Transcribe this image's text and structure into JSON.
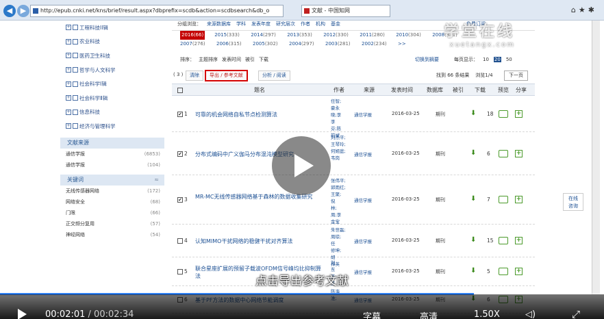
{
  "browser": {
    "url": "http://epub.cnki.net/kns/brief/result.aspx?dbprefix=scdb&action=scdbsearch&db_o",
    "tab_title": "文献 - 中国知网",
    "icons": [
      "home-icon",
      "star-icon",
      "gear-icon"
    ]
  },
  "sidebar": {
    "categories": [
      {
        "label": "工程科技II辑"
      },
      {
        "label": "农业科技"
      },
      {
        "label": "医药卫生科技"
      },
      {
        "label": "哲学与人文科学"
      },
      {
        "label": "社会科学Ⅰ辑"
      },
      {
        "label": "社会科学Ⅱ辑"
      },
      {
        "label": "信息科技"
      },
      {
        "label": "经济与管理科学"
      }
    ],
    "sources_title": "文献来源",
    "sources": [
      {
        "label": "通信学报",
        "count": "(6853)"
      },
      {
        "label": "通信学报",
        "count": "(104)"
      }
    ],
    "keywords_title": "关键词",
    "keywords_toggle": "≈",
    "keywords": [
      {
        "label": "无线传感器网络",
        "count": "(172)"
      },
      {
        "label": "网络安全",
        "count": "(68)"
      },
      {
        "label": "门限",
        "count": "(66)"
      },
      {
        "label": "正交频分复用",
        "count": "(57)"
      },
      {
        "label": "神经网络",
        "count": "(54)"
      }
    ]
  },
  "filters": {
    "items": [
      "分组浏览：",
      "来源数据库",
      "学科",
      "发表年度",
      "研究层次",
      "作者",
      "机构",
      "基金"
    ],
    "right_text": "免费订阅"
  },
  "years": {
    "row1": [
      {
        "y": "2016",
        "n": "(66)",
        "selected": true
      },
      {
        "y": "2015",
        "n": "(333)"
      },
      {
        "y": "2014",
        "n": "(297)"
      },
      {
        "y": "2013",
        "n": "(353)"
      },
      {
        "y": "2012",
        "n": "(330)"
      },
      {
        "y": "2011",
        "n": "(280)"
      },
      {
        "y": "2010",
        "n": "(304)"
      },
      {
        "y": "2008",
        "n": "(371)"
      }
    ],
    "row2": [
      {
        "y": "2007",
        "n": "(276)"
      },
      {
        "y": "2006",
        "n": "(315)"
      },
      {
        "y": "2005",
        "n": "(302)"
      },
      {
        "y": "2004",
        "n": "(297)"
      },
      {
        "y": "2003",
        "n": "(281)"
      },
      {
        "y": "2002",
        "n": "(234)"
      },
      {
        "y": ">>",
        "n": ""
      }
    ]
  },
  "sortbar": {
    "items": [
      "排序：",
      "主题排序",
      "发表时间",
      "被引",
      "下载"
    ],
    "switch_label": "切换到摘要",
    "per_page_label": "每页显示：",
    "page_sizes": [
      "10",
      "20",
      "50"
    ],
    "selected_size": "20"
  },
  "toolbar": {
    "selected_count": "( 3 )",
    "clear": "清除",
    "export": "导出 / 参考文献",
    "analyze": "分析 / 阅读",
    "result_info": "找到 66 条结果",
    "page_info": "浏览1/4",
    "next": "下一页"
  },
  "table": {
    "headers": {
      "select": "",
      "title": "题名",
      "author": "作者",
      "source": "来源",
      "date": "发表时间",
      "db": "数据库",
      "cited": "被引",
      "download": "下载",
      "preview": "预览",
      "share": "分享"
    },
    "rows": [
      {
        "checked": true,
        "num": "1",
        "title": "可靠的机会网络自私节点检测算法",
        "authors": [
          "任智;",
          "豪永",
          "晓;李",
          "李",
          "芬;陈",
          "前斌"
        ],
        "source": "通信学报",
        "date": "2016-03-25",
        "db": "期刊",
        "downloads": "18"
      },
      {
        "checked": true,
        "num": "2",
        "title": "分布式编码中广义伽马分布混沌模型研究",
        "authors": [
          "刘杰平;",
          "王琴玲;",
          "何姬庭;",
          "韦岗"
        ],
        "source": "通信学报",
        "date": "2016-03-25",
        "db": "期刊",
        "downloads": "6"
      },
      {
        "checked": true,
        "num": "3",
        "title": "MR-MC无线传感器网络基于森林的数据收集研究",
        "authors": [
          "张伟平;",
          "郭雨红;",
          "王聚;",
          "倪",
          "林;",
          "周;李",
          "金宝"
        ],
        "source": "通信学报",
        "date": "2016-03-25",
        "db": "期刊",
        "downloads": "7"
      },
      {
        "checked": false,
        "num": "4",
        "title": "认知MIMO干扰网络的稳健干扰对齐算法",
        "authors": [
          "朱世磊;",
          "周琼;",
          "任",
          "修坤;",
          "胡",
          "捍英"
        ],
        "source": "通信学报",
        "date": "2016-03-25",
        "db": "期刊",
        "downloads": "15"
      },
      {
        "checked": false,
        "num": "5",
        "title": "联合星座扩展的预留子载波OFDM信号峰均比抑制算法",
        "authors": [
          "刘",
          "东",
          "王;",
          "王"
        ],
        "source": "通信学报",
        "date": "2016-03-25",
        "db": "期刊",
        "downloads": "5"
      },
      {
        "checked": false,
        "num": "6",
        "title": "基于PF方法的数据中心网络节能调度",
        "authors": [
          "陈海",
          "淮;"
        ],
        "source": "通信学报",
        "date": "2016-03-25",
        "db": "期刊",
        "downloads": "6"
      }
    ]
  },
  "watermark": {
    "big": "学堂在线",
    "small": "xuetangx.com"
  },
  "consult": {
    "line1": "在线",
    "line2": "咨询"
  },
  "player": {
    "subtitle": "点击导出参考文献",
    "current_time": "00:02:01",
    "total_time": "/ 00:02:34",
    "progress": 0.785,
    "captions_label": "字幕",
    "quality_label": "高清",
    "speed_label": "1.50X"
  }
}
